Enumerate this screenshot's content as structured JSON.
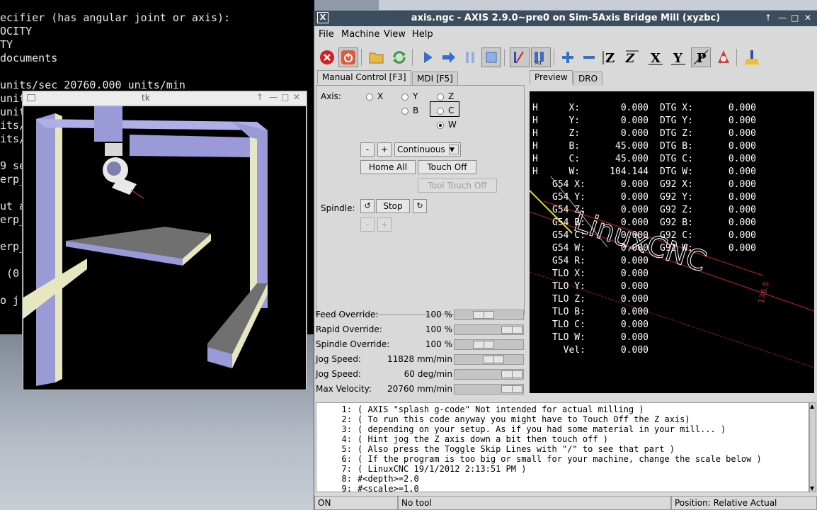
{
  "terminal": {
    "lines": [
      "ecifier (has angular joint or axis):",
      "OCITY",
      "TY",
      "documents",
      "",
      "units/sec 20760.000 units/min",
      "unit",
      "unit",
      "its/",
      "its/",
      "",
      "9 se",
      "erp_",
      "",
      "ut a",
      "erp_",
      "",
      "erp_",
      "",
      " (0",
      "",
      "o j"
    ]
  },
  "tk": {
    "title": "tk",
    "controls": [
      "↑",
      "—",
      "□",
      "✕"
    ]
  },
  "axis": {
    "title": "axis.ngc - AXIS 2.9.0~pre0 on Sim-5Axis Bridge Mill (xyzbc)",
    "logo": "X",
    "controls": [
      "↑",
      "—",
      "□",
      "✕"
    ],
    "menu": [
      "File",
      "Machine",
      "View",
      "Help"
    ],
    "toolbar_icons": [
      "estop-icon",
      "power-icon",
      "open-file-icon",
      "reload-icon",
      "run-icon",
      "step-icon",
      "pause-icon",
      "stop-icon",
      "skip-lines-icon",
      "optional-stop-icon",
      "zoom-in-icon",
      "zoom-out-icon",
      "view-z-icon",
      "view-z2-icon",
      "view-x-icon",
      "view-y-icon",
      "view-p-icon",
      "rotate-view-icon",
      "clear-plot-icon"
    ],
    "tabs_left": [
      "Manual Control [F3]",
      "MDI [F5]"
    ],
    "tabs_right": [
      "Preview",
      "DRO"
    ],
    "manual": {
      "axis_label": "Axis:",
      "axes": [
        "X",
        "Y",
        "Z",
        "B",
        "C",
        "W"
      ],
      "selected_axis": "W",
      "minus": "-",
      "plus": "+",
      "jog_mode": "Continuous",
      "home_all": "Home All",
      "touch_off": "Touch Off",
      "tool_touch_off": "Tool Touch Off",
      "spindle_label": "Spindle:",
      "spindle_stop": "Stop",
      "spindle_minus": "-",
      "spindle_plus": "+"
    },
    "overrides": [
      {
        "label": "Feed Override:",
        "value": "100 %",
        "level": 0.4
      },
      {
        "label": "Rapid Override:",
        "value": "100 %",
        "level": 1.0
      },
      {
        "label": "Spindle Override:",
        "value": "100 %",
        "level": 0.4
      },
      {
        "label": "Jog Speed:",
        "value": "11828 mm/min",
        "level": 0.6
      },
      {
        "label": "Jog Speed:",
        "value": "60 deg/min",
        "level": 1.0
      },
      {
        "label": "Max Velocity:",
        "value": "20760 mm/min",
        "level": 1.0
      }
    ],
    "dro": [
      {
        "pre": "H",
        "mid": "   X:",
        "val": "0.000",
        "dtg": "DTG X:",
        "dval": "0.000"
      },
      {
        "pre": "H",
        "mid": "   Y:",
        "val": "0.000",
        "dtg": "DTG Y:",
        "dval": "0.000"
      },
      {
        "pre": "H",
        "mid": "   Z:",
        "val": "0.000",
        "dtg": "DTG Z:",
        "dval": "0.000"
      },
      {
        "pre": "H",
        "mid": "   B:",
        "val": "45.000",
        "dtg": "DTG B:",
        "dval": "0.000"
      },
      {
        "pre": "H",
        "mid": "   C:",
        "val": "45.000",
        "dtg": "DTG C:",
        "dval": "0.000"
      },
      {
        "pre": "H",
        "mid": "   W:",
        "val": "104.144",
        "dtg": "DTG W:",
        "dval": "0.000"
      },
      {
        "pre": "",
        "mid": "G54 X:",
        "val": "0.000",
        "dtg": "G92 X:",
        "dval": "0.000"
      },
      {
        "pre": "",
        "mid": "G54 Y:",
        "val": "0.000",
        "dtg": "G92 Y:",
        "dval": "0.000"
      },
      {
        "pre": "",
        "mid": "G54 Z:",
        "val": "0.000",
        "dtg": "G92 Z:",
        "dval": "0.000"
      },
      {
        "pre": "",
        "mid": "G54 B:",
        "val": "0.000",
        "dtg": "G92 B:",
        "dval": "0.000"
      },
      {
        "pre": "",
        "mid": "G54 C:",
        "val": "0.000",
        "dtg": "G92 C:",
        "dval": "0.000"
      },
      {
        "pre": "",
        "mid": "G54 W:",
        "val": "0.000",
        "dtg": "G92 W:",
        "dval": "0.000"
      },
      {
        "pre": "",
        "mid": "G54 R:",
        "val": "0.000",
        "dtg": "",
        "dval": ""
      },
      {
        "pre": "",
        "mid": "TLO X:",
        "val": "0.000",
        "dtg": "",
        "dval": ""
      },
      {
        "pre": "",
        "mid": "TLO Y:",
        "val": "0.000",
        "dtg": "",
        "dval": ""
      },
      {
        "pre": "",
        "mid": "TLO Z:",
        "val": "0.000",
        "dtg": "",
        "dval": ""
      },
      {
        "pre": "",
        "mid": "TLO B:",
        "val": "0.000",
        "dtg": "",
        "dval": ""
      },
      {
        "pre": "",
        "mid": "TLO C:",
        "val": "0.000",
        "dtg": "",
        "dval": ""
      },
      {
        "pre": "",
        "mid": "TLO W:",
        "val": "0.000",
        "dtg": "",
        "dval": ""
      },
      {
        "pre": "",
        "mid": "  Vel:",
        "val": "0.000",
        "dtg": "",
        "dval": ""
      }
    ],
    "preview_text": "LinuxCNC",
    "preview_dim": "136.5",
    "gcode": [
      {
        "n": "1:",
        "text": "( AXIS \"splash g-code\" Not intended for actual milling )"
      },
      {
        "n": "2:",
        "text": "( To run this code anyway you might have to Touch Off the Z axis)"
      },
      {
        "n": "3:",
        "text": "( depending on your setup. As if you had some material in your mill... )"
      },
      {
        "n": "4:",
        "text": "( Hint jog the Z axis down a bit then touch off )"
      },
      {
        "n": "5:",
        "text": "( Also press the Toggle Skip Lines with \"/\" to see that part )"
      },
      {
        "n": "6:",
        "text": "( If the program is too big or small for your machine, change the scale below )"
      },
      {
        "n": "7:",
        "text": "( LinuxCNC 19/1/2012 2:13:51 PM )"
      },
      {
        "n": "8:",
        "text": "#<depth>=2.0"
      },
      {
        "n": "9:",
        "text": "#<scale>=1.0"
      }
    ],
    "status": {
      "state": "ON",
      "tool": "No tool",
      "position": "Position: Relative Actual"
    }
  }
}
